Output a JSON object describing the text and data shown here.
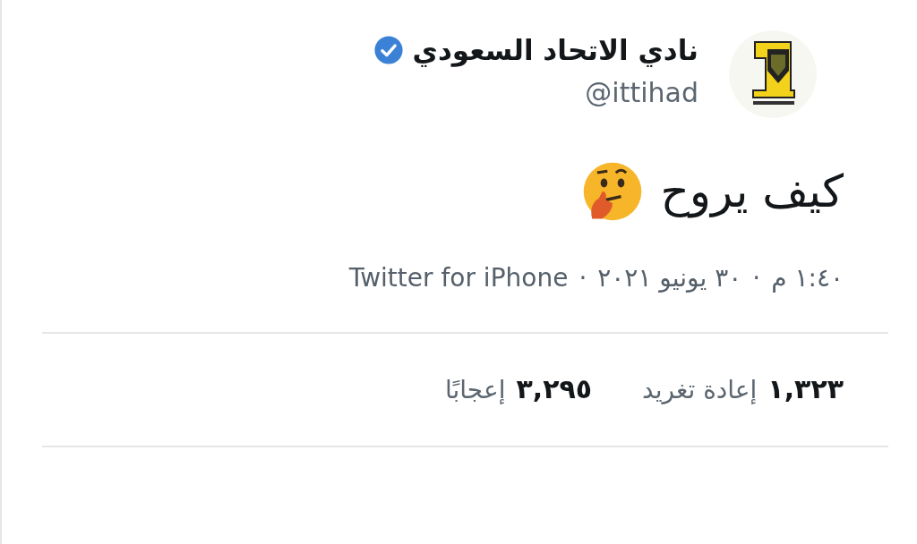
{
  "author": {
    "name": "نادي الاتحاد السعودي",
    "verified": true,
    "handle": "@ittihad"
  },
  "tweet": {
    "text": "كيف يروح"
  },
  "meta": {
    "time": "١:٤٠ م",
    "separator_1": "·",
    "date": "٣٠ يونيو ٢٠٢١",
    "separator_2": "·",
    "source": "Twitter for iPhone"
  },
  "stats": [
    {
      "count": "١,٣٢٣",
      "label": "إعادة تغريد"
    },
    {
      "count": "٣,٢٩٥",
      "label": "إعجابًا"
    }
  ]
}
